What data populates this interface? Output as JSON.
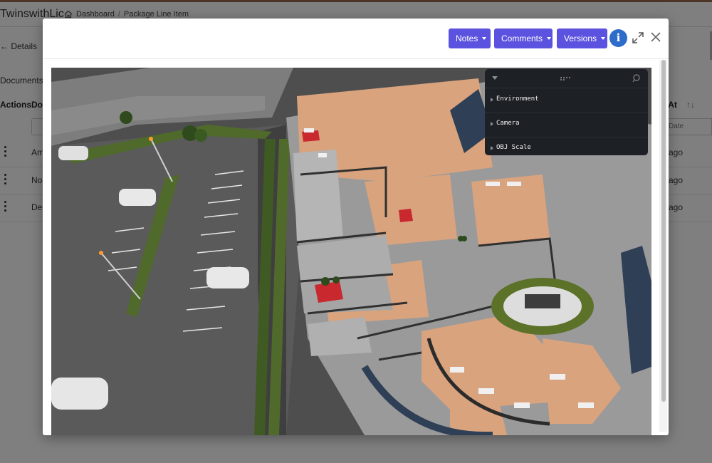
{
  "app": {
    "brand": "TwinswithLic",
    "breadcrumb": {
      "home": "Dashboard",
      "current": "Package Line Item"
    },
    "back_label": "Details",
    "documents_tab": "Documents",
    "table": {
      "headers": {
        "actions": "Actions",
        "doc": "Do",
        "updated": "d At",
        "sort_icon": "sort-icon"
      },
      "filter_placeholder": "Date",
      "rows": [
        {
          "name": "Am",
          "ago": "ago"
        },
        {
          "name": "No",
          "ago": "ago"
        },
        {
          "name": "De",
          "ago": "ago"
        }
      ]
    }
  },
  "modal": {
    "toolbar": {
      "notes": "Notes",
      "comments": "Comments",
      "versions": "Versions",
      "info_glyph": "i"
    },
    "gui": {
      "folders": [
        "Environment",
        "Camera",
        "OBJ Scale"
      ]
    }
  },
  "colors": {
    "accent": "#5c52e0",
    "info": "#2d6cc8",
    "gui_bg": "#1d2024",
    "floor": "#d9a37e",
    "grass": "#4f6a2a"
  }
}
